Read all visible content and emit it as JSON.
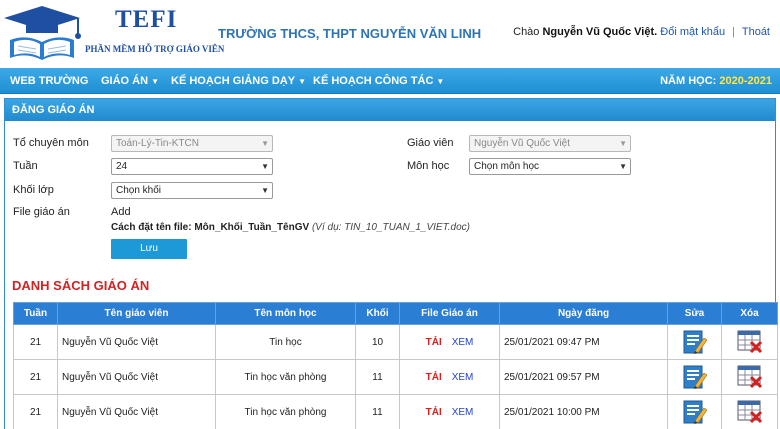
{
  "header": {
    "brand": "TEFI",
    "brand_sub": "PHẦN MỀM HỖ TRỢ GIÁO VIÊN",
    "school": "TRƯỜNG THCS, THPT NGUYỄN VĂN LINH",
    "greeting": "Chào",
    "user_name": "Nguyễn Vũ Quốc Việt.",
    "change_password": "Đổi mật khẩu",
    "separator": "|",
    "logout": "Thoát"
  },
  "nav": {
    "items": [
      {
        "label": "WEB TRƯỜNG",
        "caret": ""
      },
      {
        "label": "GIÁO ÁN",
        "caret": "▼"
      },
      {
        "label": "KẾ HOẠCH GIẢNG DẠY",
        "caret": "▼"
      },
      {
        "label": "KẾ HOẠCH CÔNG TÁC",
        "caret": "▼"
      }
    ],
    "year_label": "NĂM HỌC:",
    "year_value": "2020-2021"
  },
  "form": {
    "title": "ĐĂNG GIÁO ÁN",
    "department_label": "Tổ chuyên môn",
    "department_value": "Toán-Lý-Tin-KTCN",
    "week_label": "Tuần",
    "week_value": "24",
    "grade_label": "Khối lớp",
    "grade_value": "Chọn khối",
    "file_label": "File giáo án",
    "file_value": "Add",
    "teacher_label": "Giáo viên",
    "teacher_value": "Nguyễn Vũ Quốc Việt",
    "subject_label": "Môn học",
    "subject_value": "Chọn môn học",
    "naming_prefix": "Cách đặt tên file: Môn_Khối_Tuần_TênGV",
    "naming_example": "(Ví dụ: TIN_10_TUAN_1_VIET.doc)",
    "save_label": "Lưu"
  },
  "list": {
    "title": "DANH SÁCH GIÁO ÁN",
    "columns": [
      "Tuần",
      "Tên giáo viên",
      "Tên môn học",
      "Khối",
      "File Giáo án",
      "Ngày đăng",
      "Sửa",
      "Xóa"
    ],
    "download_label": "TẢI",
    "view_label": "XEM",
    "rows": [
      {
        "week": "21",
        "teacher": "Nguyễn Vũ Quốc Việt",
        "subject": "Tin học",
        "grade": "10",
        "date": "25/01/2021 09:47 PM"
      },
      {
        "week": "21",
        "teacher": "Nguyễn Vũ Quốc Việt",
        "subject": "Tin học văn phòng",
        "grade": "11",
        "date": "25/01/2021 09:57 PM"
      },
      {
        "week": "21",
        "teacher": "Nguyễn Vũ Quốc Việt",
        "subject": "Tin học văn phòng",
        "grade": "11",
        "date": "25/01/2021 10:00 PM"
      }
    ]
  },
  "colors": {
    "nav_bg": "#2196d8",
    "year_highlight": "#ffe64d",
    "list_title": "#d22323",
    "table_head": "#2a7ed4",
    "button": "#1c9ad8"
  }
}
